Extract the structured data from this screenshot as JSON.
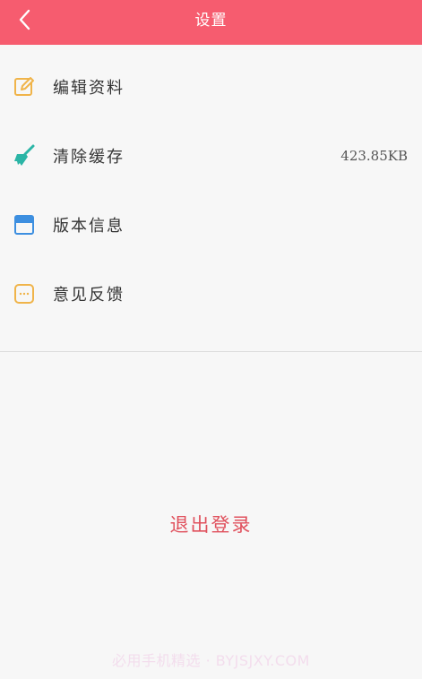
{
  "header": {
    "title": "设置",
    "back_icon": "chevron-left-icon",
    "color": "#f65c6f"
  },
  "menu": {
    "items": [
      {
        "label": "编辑资料",
        "icon": "edit-icon",
        "value": ""
      },
      {
        "label": "清除缓存",
        "icon": "broom-icon",
        "value": "423.85KB"
      },
      {
        "label": "版本信息",
        "icon": "version-icon",
        "value": ""
      },
      {
        "label": "意见反馈",
        "icon": "feedback-icon",
        "value": ""
      }
    ]
  },
  "logout": {
    "label": "退出登录",
    "color": "#e0505c"
  },
  "watermark": {
    "text": "必用手机精选 · BYJSJXY.COM"
  }
}
